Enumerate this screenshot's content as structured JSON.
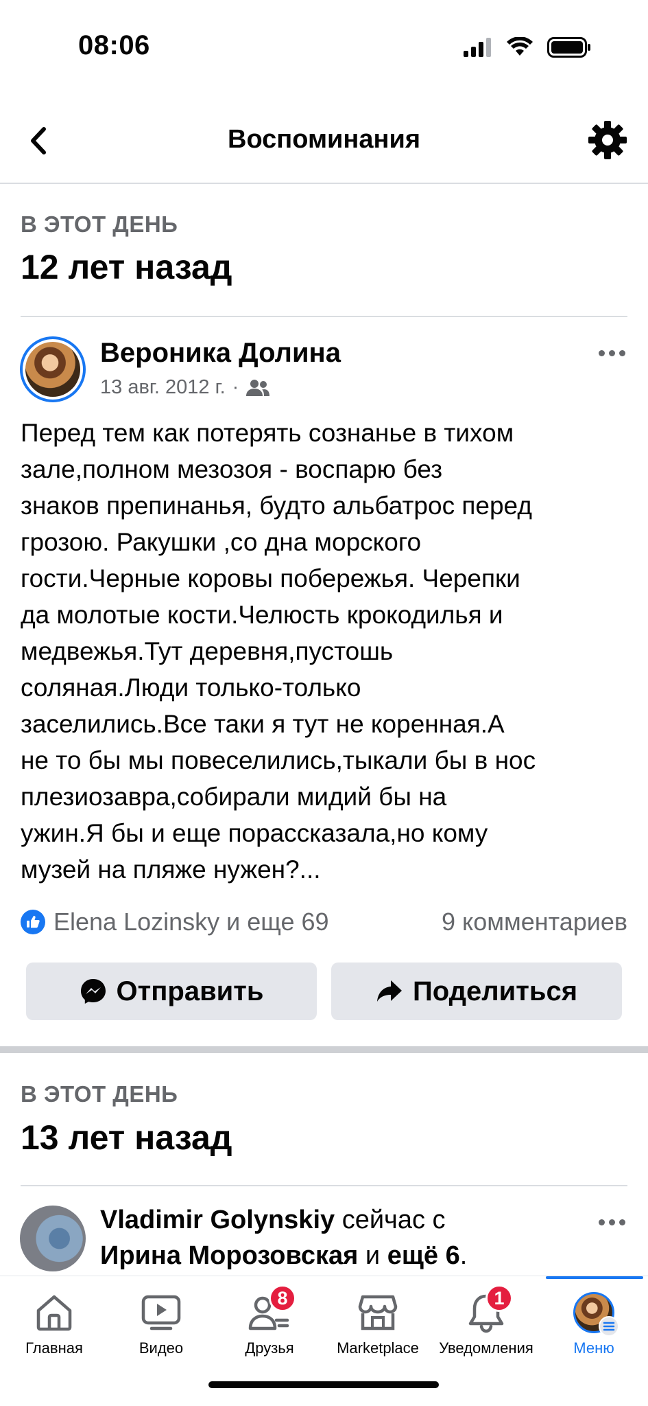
{
  "status_bar": {
    "time": "08:06"
  },
  "header": {
    "title": "Воспоминания"
  },
  "memory1": {
    "kicker": "В ЭТОТ ДЕНЬ",
    "years_ago": "12 лет назад",
    "post": {
      "author": "Вероника Долина",
      "date": "13 авг. 2012 г.",
      "separator": "·",
      "text": "Перед тем как потерять сознанье в тихом\nзале,полном мезозоя - воспарю без\nзнаков препинанья, будто альбатрос перед\nгрозою. Ракушки ,со дна морского\nгости.Черные коровы побережья. Черепки\nда молотые кости.Челюсть крокодилья и\nмедвежья.Тут деревня,пустошь\nсоляная.Люди только-только\nзаселились.Все таки я тут не коренная.А\nне то бы мы повеселились,тыкали бы в нос\nплезиозавра,собирали мидий бы на\nужин.Я бы и еще порассказала,но кому\nмузей на пляже нужен?...",
      "reactions": "Elena Lozinsky и еще 69",
      "comments": "9 комментариев",
      "send_label": "Отправить",
      "share_label": "Поделиться"
    }
  },
  "memory2": {
    "kicker": "В ЭТОТ ДЕНЬ",
    "years_ago": "13 лет назад",
    "post": {
      "author": "Vladimir Golynskiy",
      "with_text": " сейчас с",
      "tagged": "Ирина Морозовская",
      "and_text": " и ",
      "others": "ещё 6",
      "period": "."
    }
  },
  "tab_bar": {
    "items": [
      {
        "label": "Главная",
        "icon": "home-icon"
      },
      {
        "label": "Видео",
        "icon": "video-icon"
      },
      {
        "label": "Друзья",
        "icon": "friends-icon",
        "badge": "8"
      },
      {
        "label": "Marketplace",
        "icon": "marketplace-icon"
      },
      {
        "label": "Уведомления",
        "icon": "bell-icon",
        "badge": "1"
      },
      {
        "label": "Меню",
        "icon": "menu-avatar",
        "active": true
      }
    ]
  },
  "colors": {
    "accent": "#1877f2",
    "badge": "#e41e3f",
    "secondary_text": "#65676b",
    "button_bg": "#e4e6eb"
  }
}
